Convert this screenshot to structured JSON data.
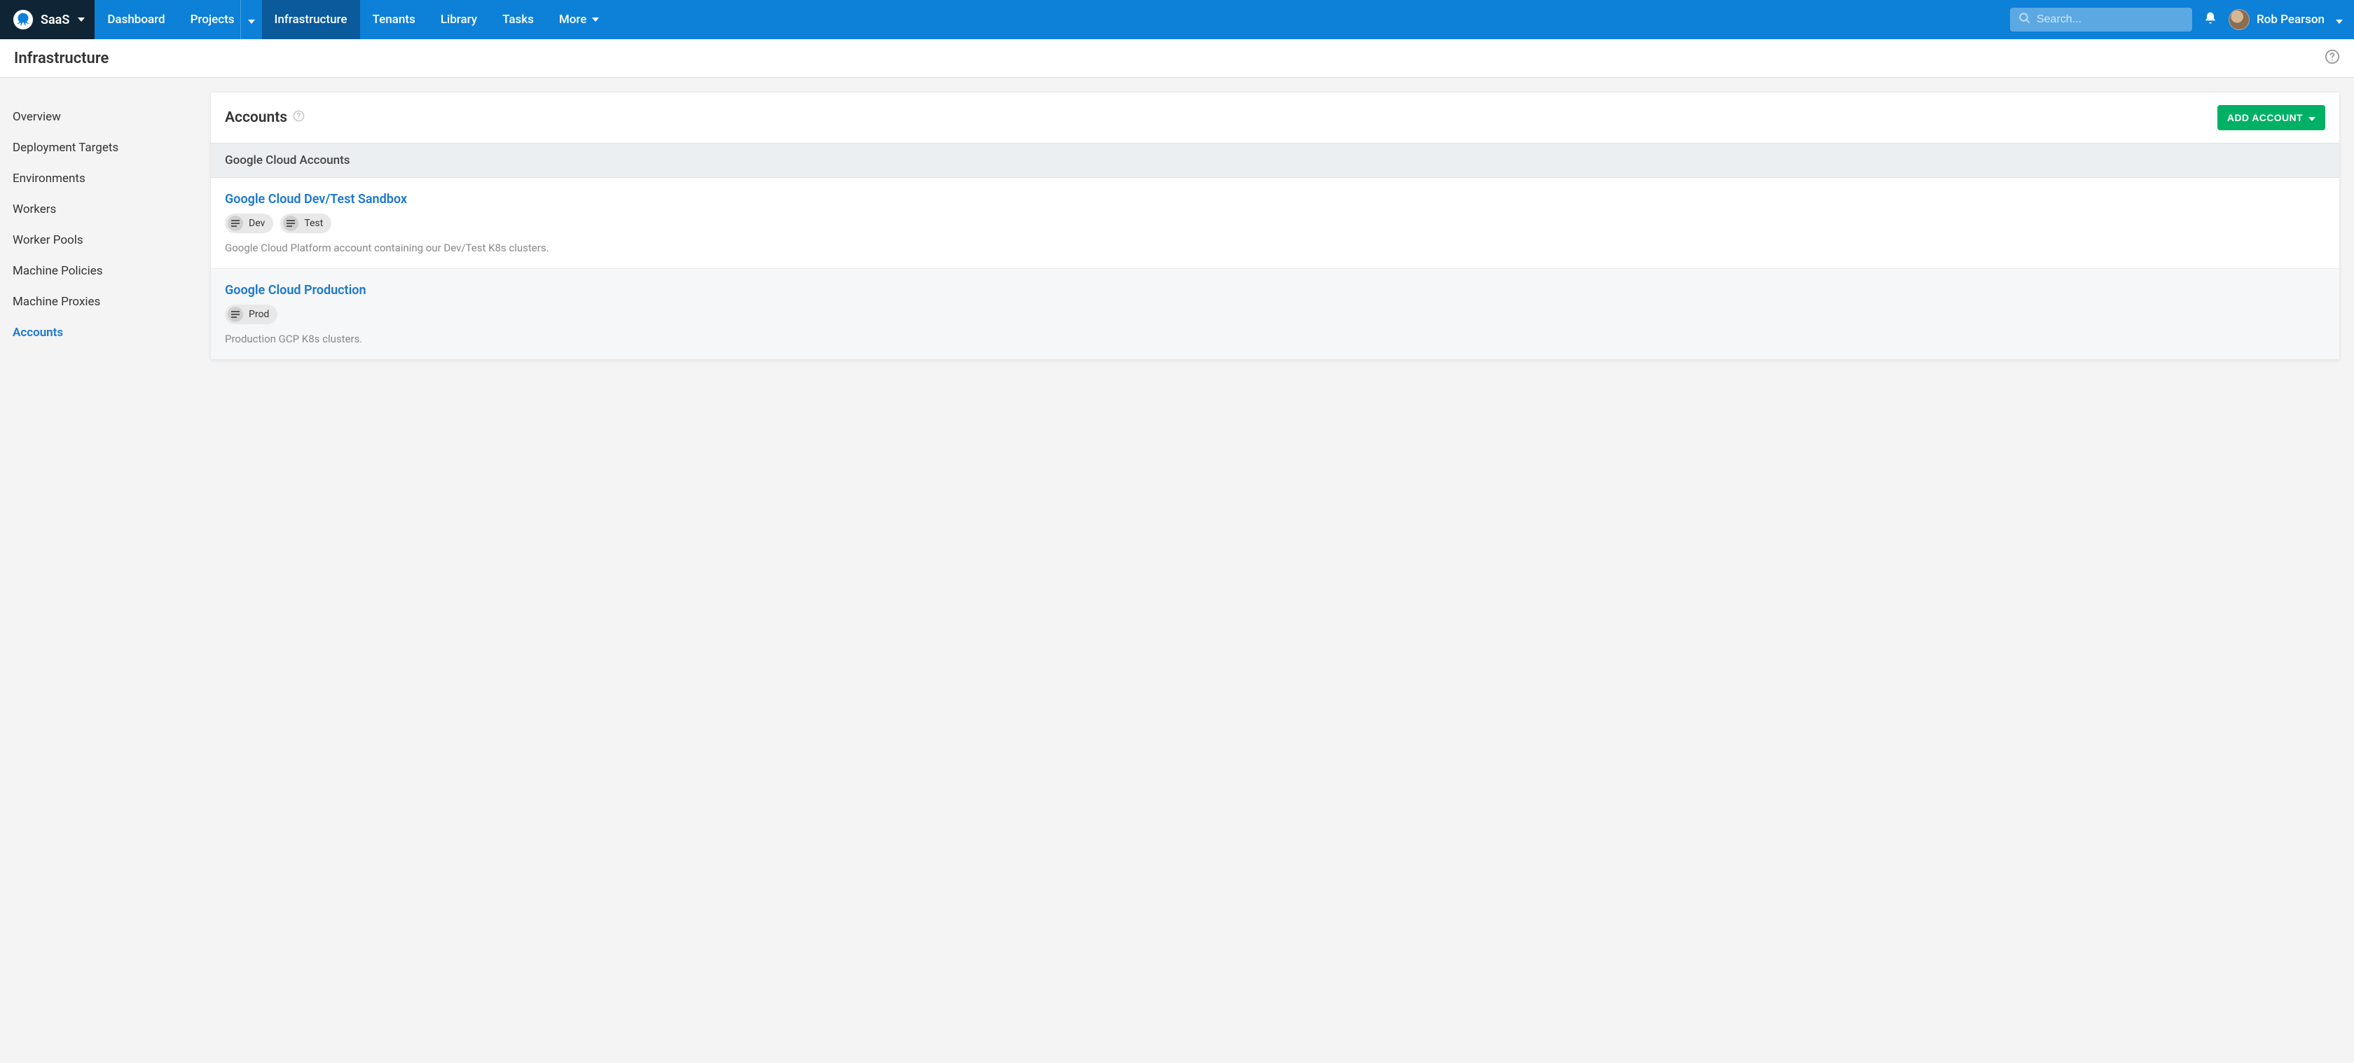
{
  "brand": {
    "name": "SaaS"
  },
  "nav": {
    "items": [
      {
        "label": "Dashboard",
        "hasCaret": false
      },
      {
        "label": "Projects",
        "hasCaret": true
      },
      {
        "label": "Infrastructure",
        "hasCaret": false,
        "active": true
      },
      {
        "label": "Tenants",
        "hasCaret": false
      },
      {
        "label": "Library",
        "hasCaret": false
      },
      {
        "label": "Tasks",
        "hasCaret": false
      },
      {
        "label": "More",
        "hasCaret": true,
        "caretInline": true
      }
    ]
  },
  "search": {
    "placeholder": "Search..."
  },
  "user": {
    "name": "Rob Pearson"
  },
  "page": {
    "title": "Infrastructure"
  },
  "sidebar": {
    "items": [
      {
        "label": "Overview"
      },
      {
        "label": "Deployment Targets"
      },
      {
        "label": "Environments"
      },
      {
        "label": "Workers"
      },
      {
        "label": "Worker Pools"
      },
      {
        "label": "Machine Policies"
      },
      {
        "label": "Machine Proxies"
      },
      {
        "label": "Accounts",
        "active": true
      }
    ]
  },
  "content": {
    "title": "Accounts",
    "addButton": "ADD ACCOUNT",
    "sectionTitle": "Google Cloud Accounts",
    "accounts": [
      {
        "name": "Google Cloud Dev/Test Sandbox",
        "tags": [
          "Dev",
          "Test"
        ],
        "description": "Google Cloud Platform account containing our Dev/Test K8s clusters."
      },
      {
        "name": "Google Cloud Production",
        "tags": [
          "Prod"
        ],
        "description": "Production GCP K8s clusters."
      }
    ]
  }
}
